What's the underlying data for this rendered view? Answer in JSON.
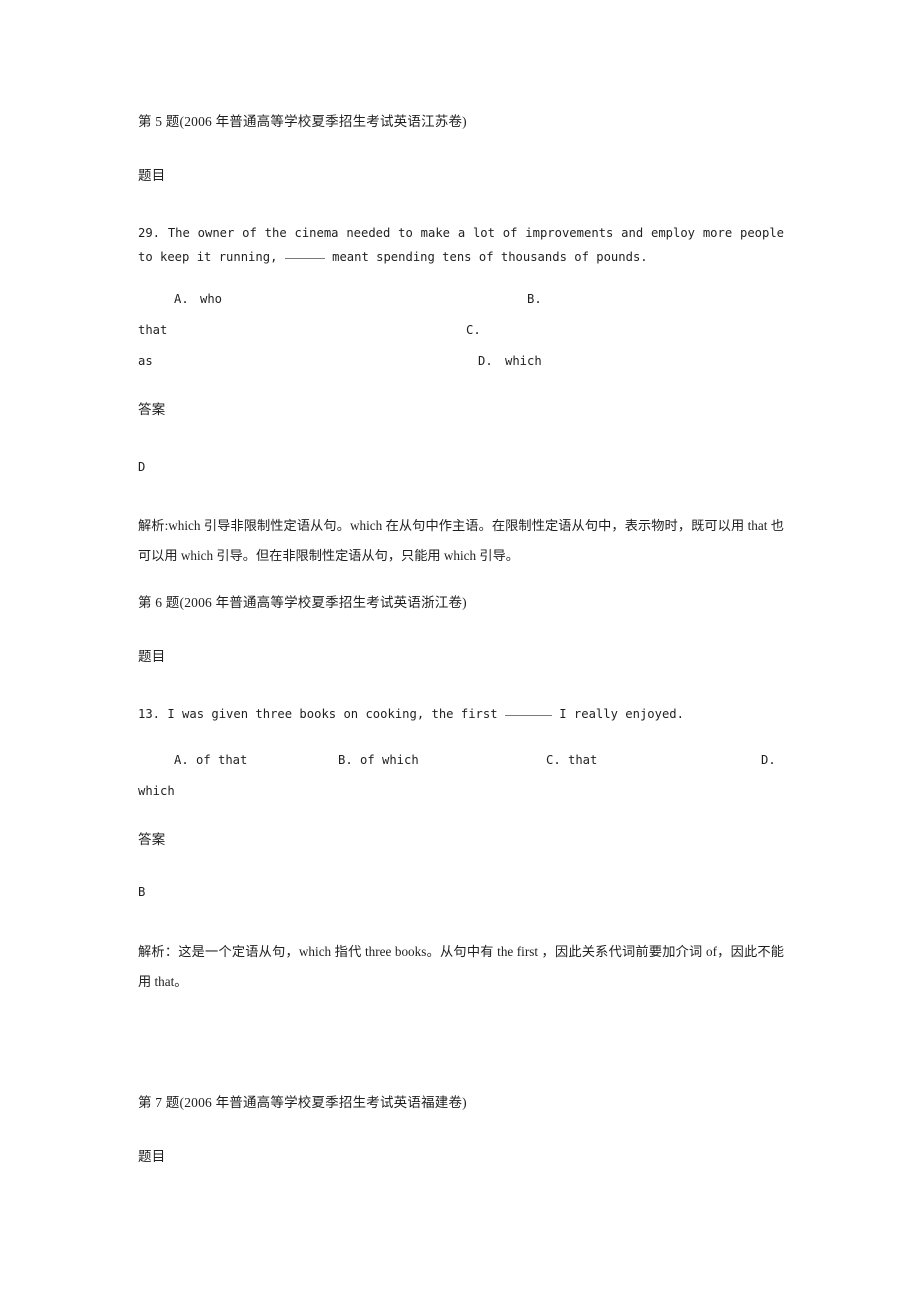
{
  "document": {
    "page_background": "#ffffff",
    "text_color": "#1f1f1f"
  },
  "blocks": [
    {
      "id": "q5",
      "heading": "第 5 题(2006 年普通高等学校夏季招生考试英语江苏卷)",
      "section_question_label": "题目",
      "question_number": "29.",
      "stem_part1": "The owner of the cinema needed to make a lot of improvements and employ more people to keep it running,",
      "stem_part2": "meant spending tens of thousands of pounds.",
      "options": [
        {
          "letter": "A.",
          "text": "who"
        },
        {
          "letter": "B.",
          "text": "that"
        },
        {
          "letter": "C.",
          "text": "as"
        },
        {
          "letter": "D.",
          "text": "which"
        }
      ],
      "section_answer_label": "答案",
      "answer": "D",
      "explanation_label": "解析:",
      "explanation": "which 引导非限制性定语从句。which 在从句中作主语。在限制性定语从句中，表示物时，既可以用 that 也可以用 which 引导。但在非限制性定语从句，只能用 which 引导。"
    },
    {
      "id": "q6",
      "heading": "第 6 题(2006 年普通高等学校夏季招生考试英语浙江卷)",
      "section_question_label": "题目",
      "question_number": "13.",
      "stem_part1": "I was given three books on cooking, the first",
      "stem_part2": "I really enjoyed.",
      "options": [
        {
          "letter": "A.",
          "text": "of that"
        },
        {
          "letter": "B.",
          "text": "of which"
        },
        {
          "letter": "C.",
          "text": "that"
        },
        {
          "letter": "D.",
          "text": "which"
        }
      ],
      "section_answer_label": "答案",
      "answer": "B",
      "explanation_label": "解析：",
      "explanation": "这是一个定语从句，which 指代 three books。从句中有 the first ，因此关系代词前要加介词 of，因此不能用 that。"
    },
    {
      "id": "q7",
      "heading": "第 7 题(2006 年普通高等学校夏季招生考试英语福建卷)",
      "section_question_label": "题目"
    }
  ]
}
